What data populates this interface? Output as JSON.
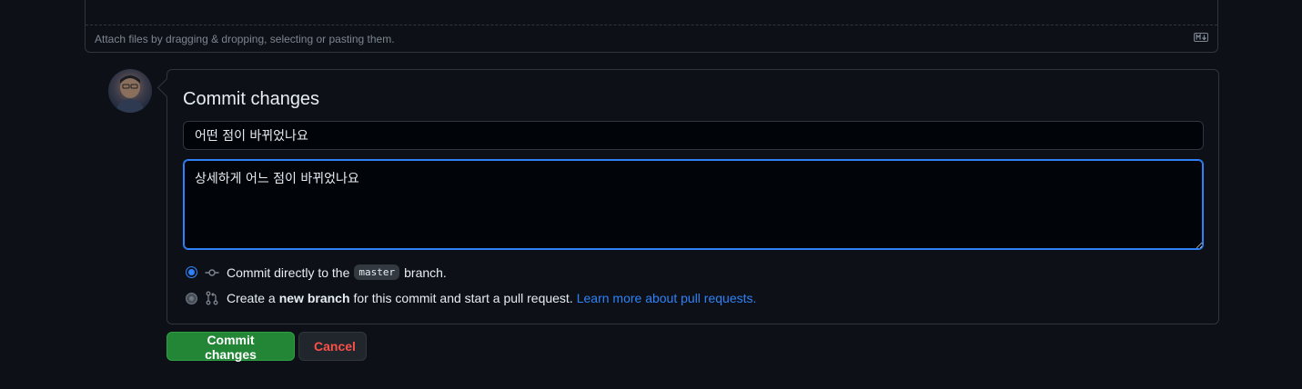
{
  "attach": {
    "hint": "Attach files by dragging & dropping, selecting or pasting them."
  },
  "commit": {
    "title": "Commit changes",
    "summary_value": "어떤 점이 바뀌었나요",
    "description_value": "상세하게 어느 점이 바뀌었나요",
    "option_direct": {
      "prefix": "Commit directly to the",
      "branch": "master",
      "suffix": "branch.",
      "selected": true
    },
    "option_new_branch": {
      "prefix": "Create a",
      "bold": "new branch",
      "suffix": "for this commit and start a pull request.",
      "link": "Learn more about pull requests.",
      "selected": false
    }
  },
  "buttons": {
    "commit_label": "Commit changes",
    "cancel_label": "Cancel"
  },
  "icons": {
    "markdown": "markdown-icon",
    "commit": "git-commit-icon",
    "pull_request": "git-pull-request-icon"
  },
  "colors": {
    "background": "#0d1117",
    "border": "#30363d",
    "accent": "#2f81f7",
    "primary_button": "#238636",
    "danger_text": "#f85149"
  }
}
